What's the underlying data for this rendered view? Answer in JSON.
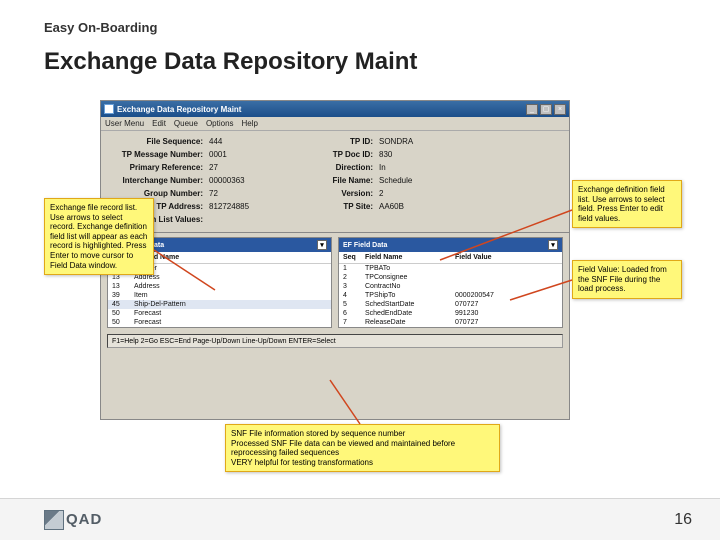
{
  "slide": {
    "heading": "Easy On-Boarding",
    "title": "Exchange Data Repository Maint",
    "page_number": "16",
    "logo_text": "QAD"
  },
  "window": {
    "title": "Exchange Data Repository Maint",
    "menu": [
      "User Menu",
      "Edit",
      "Queue",
      "Options",
      "Help"
    ],
    "header": {
      "left": [
        {
          "label": "File Sequence:",
          "value": "444"
        },
        {
          "label": "TP Message Number:",
          "value": "0001"
        },
        {
          "label": "Primary Reference:",
          "value": "27"
        },
        {
          "label": "Interchange Number:",
          "value": "00000363"
        },
        {
          "label": "Group Number:",
          "value": "72"
        },
        {
          "label": "TP Address:",
          "value": "812724885"
        },
        {
          "label": "Token List Values:",
          "value": ""
        }
      ],
      "right": [
        {
          "label": "TP ID:",
          "value": "SONDRA"
        },
        {
          "label": "TP Doc ID:",
          "value": "830"
        },
        {
          "label": "Direction:",
          "value": "In"
        },
        {
          "label": "File Name:",
          "value": "Schedule"
        },
        {
          "label": "Version:",
          "value": "2"
        },
        {
          "label": "TP Site:",
          "value": "AA60B"
        }
      ]
    },
    "table_left": {
      "title": "EF Record Data",
      "columns": [
        "Seq",
        "Record Name"
      ],
      "rows": [
        {
          "seq": "1",
          "name": "Header"
        },
        {
          "seq": "13",
          "name": "Address"
        },
        {
          "seq": "13",
          "name": "Address"
        },
        {
          "seq": "39",
          "name": "Item"
        },
        {
          "seq": "45",
          "name": "Ship-Del-Pattern"
        },
        {
          "seq": "50",
          "name": "Forecast"
        },
        {
          "seq": "50",
          "name": "Forecast"
        }
      ],
      "highlight_index": 4
    },
    "table_right": {
      "title": "EF Field Data",
      "columns": [
        "Seq",
        "Field Name",
        "Field Value"
      ],
      "rows": [
        {
          "seq": "1",
          "name": "TPBATo",
          "value": ""
        },
        {
          "seq": "2",
          "name": "TPConsignee",
          "value": ""
        },
        {
          "seq": "3",
          "name": "ContractNo",
          "value": ""
        },
        {
          "seq": "4",
          "name": "TPShipTo",
          "value": "0000200547"
        },
        {
          "seq": "5",
          "name": "SchedStartDate",
          "value": "070727"
        },
        {
          "seq": "6",
          "name": "SchedEndDate",
          "value": "991230"
        },
        {
          "seq": "7",
          "name": "ReleaseDate",
          "value": "070727"
        }
      ]
    },
    "status": "F1=Help 2=Go ESC=End Page-Up/Down Line-Up/Down ENTER=Select"
  },
  "callouts": {
    "left": "Exchange file record list. Use arrows to select record. Exchange definition field list will appear as each record is highlighted. Press Enter to move cursor to Field Data window.",
    "right1": "Exchange definition field list. Use arrows to select field. Press Enter to edit field values.",
    "right2": "Field Value: Loaded from the SNF File during the load process.",
    "bottom": "SNF File information stored by sequence number\nProcessed SNF File data can be viewed and maintained before reprocessing failed sequences\nVERY helpful for testing transformations"
  }
}
